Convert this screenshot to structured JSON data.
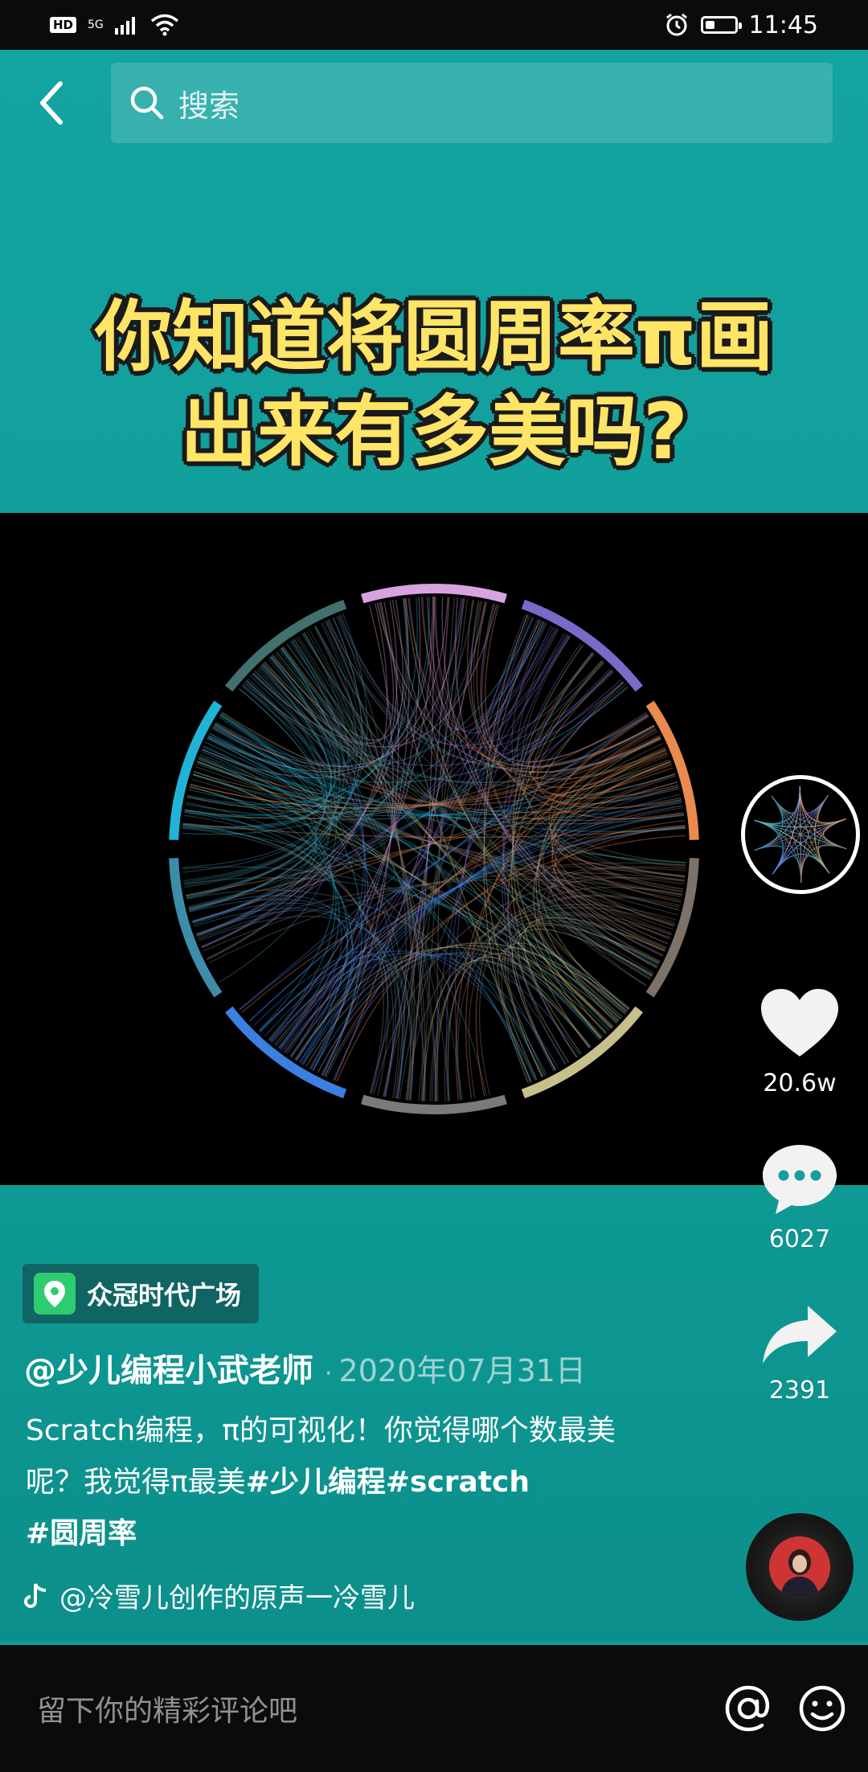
{
  "status_bar": {
    "hd": "HD",
    "network": "5G",
    "time": "11:45",
    "battery_level": 0.3
  },
  "search": {
    "placeholder": "搜索"
  },
  "video": {
    "title_line1": "你知道将圆周率π画",
    "title_line2": "出来有多美吗?"
  },
  "actions": {
    "likes": "20.6w",
    "comments": "6027",
    "shares": "2391"
  },
  "location": {
    "label": "众冠时代广场"
  },
  "post": {
    "author": "@少儿编程小武老师",
    "date": "2020年07月31日",
    "desc_text": "Scratch编程，π的可视化！你觉得哪个数最美呢？我觉得π最美",
    "tags": [
      "#少儿编程",
      "#scratch",
      "#圆周率"
    ]
  },
  "music": {
    "label": "@冷雪儿创作的原声一冷雪儿"
  },
  "comment_bar": {
    "placeholder": "留下你的精彩评论吧"
  },
  "colors": {
    "accent": "#13a3a0",
    "title_yellow": "#ffe566",
    "ring": [
      "#d8a3e0",
      "#7a69c8",
      "#e98a4e",
      "#7d726a",
      "#c6c08a",
      "#7a7a7a",
      "#3b7fe0",
      "#3d8ca8",
      "#21b3d6",
      "#41706e"
    ]
  }
}
